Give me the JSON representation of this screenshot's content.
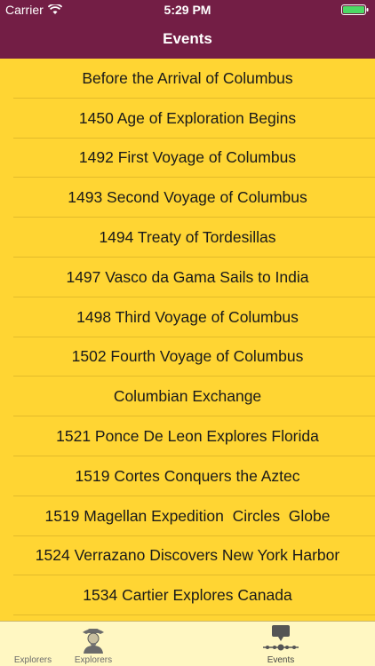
{
  "status_bar": {
    "carrier": "Carrier",
    "time": "5:29 PM"
  },
  "nav": {
    "title": "Events"
  },
  "events": [
    "Before the Arrival of Columbus",
    "1450 Age of Exploration Begins",
    "1492 First Voyage of Columbus",
    "1493 Second Voyage of Columbus",
    "1494 Treaty of Tordesillas",
    "1497 Vasco da Gama Sails to India",
    "1498 Third Voyage of Columbus",
    "1502 Fourth Voyage of Columbus",
    "Columbian Exchange",
    "1521 Ponce De Leon Explores Florida",
    "1519 Cortes Conquers the Aztec",
    "1519 Magellan Expedition  Circles  Globe",
    "1524 Verrazano Discovers New York Harbor",
    "1534 Cartier Explores Canada"
  ],
  "tabs": [
    {
      "label": "Explorers",
      "icon": "blank-icon",
      "active": false
    },
    {
      "label": "Explorers",
      "icon": "explorer-portrait-icon",
      "active": false
    },
    {
      "label": "Events",
      "icon": "timeline-icon",
      "active": true
    }
  ],
  "colors": {
    "nav_background": "#731E45",
    "list_background": "#FFD533",
    "tab_bar_background": "#FFF7C2"
  }
}
